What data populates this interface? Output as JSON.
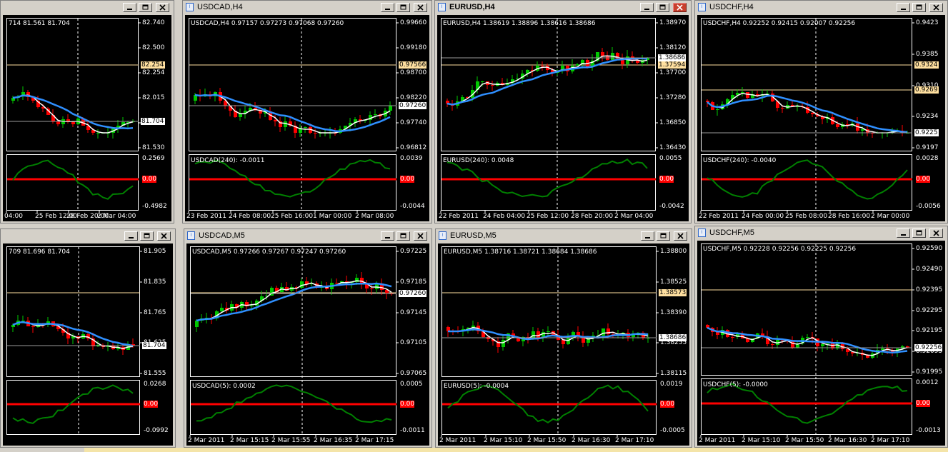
{
  "colors": {
    "bull": "#00c800",
    "bear": "#ff0000",
    "fast_ma": "#ffffff",
    "slow_ma": "#2f8fff",
    "osc": "#008000",
    "zero": "#ff0000",
    "level": "#ffe0a0"
  },
  "icons": {
    "minimize": "minimize-icon",
    "restore": "restore-icon",
    "close": "close-icon",
    "chart": "chart-window-icon"
  },
  "windows": [
    {
      "id": "w1",
      "title": "",
      "info": "714 81.561 81.704",
      "osc_label": "",
      "close_red": false,
      "price_labels": [
        "82.740",
        "82.500",
        "82.254",
        "82.015",
        "81.780",
        "81.530"
      ],
      "osc_levels": [
        "0.2569",
        "0.00",
        "-0.4982"
      ],
      "time_labels": [
        "04:00",
        "25 Feb 12:00",
        "28 Feb 20:00",
        "2 Mar 04:00"
      ],
      "current_price": "81.704",
      "level_tags": [
        "82.254"
      ]
    },
    {
      "id": "w2",
      "title": "USDCAD,H4",
      "info": "USDCAD,H4  0.97157 0.97273 0.97068 0.97260",
      "osc_label": "USDCAD(240):  -0.0011",
      "close_red": false,
      "price_labels": [
        "0.99660",
        "0.99180",
        "0.98700",
        "0.98220",
        "0.97740",
        "0.96812"
      ],
      "osc_levels": [
        "0.0039",
        "0.00",
        "-0.0044"
      ],
      "time_labels": [
        "23 Feb 2011",
        "24 Feb 08:00",
        "25 Feb 16:00",
        "1 Mar 00:00",
        "2 Mar 08:00"
      ],
      "current_price": "0.97260",
      "level_tags": [
        "0.97566"
      ]
    },
    {
      "id": "w3",
      "title": "EURUSD,H4",
      "info": "EURUSD,H4  1.38619 1.38896 1.38616 1.38686",
      "osc_label": "EURUSD(240):  0.0048",
      "close_red": true,
      "price_labels": [
        "1.38970",
        "1.38120",
        "1.37700",
        "1.37280",
        "1.36850",
        "1.36430"
      ],
      "osc_levels": [
        "0.0055",
        "0.00",
        "-0.0042"
      ],
      "time_labels": [
        "22 Feb 2011",
        "24 Feb 04:00",
        "25 Feb 12:00",
        "28 Feb 20:00",
        "2 Mar 04:00"
      ],
      "current_price": "1.38686",
      "level_tags": [
        "1.37594"
      ]
    },
    {
      "id": "w4",
      "title": "USDCHF,H4",
      "info": "USDCHF,H4  0.92252 0.92415 0.92007 0.92256",
      "osc_label": "USDCHF(240):  -0.0040",
      "close_red": false,
      "price_labels": [
        "0.9423",
        "0.9385",
        "0.9310",
        "0.9234",
        "0.9197"
      ],
      "osc_levels": [
        "0.0028",
        "0.00",
        "-0.0056"
      ],
      "time_labels": [
        "22 Feb 2011",
        "24 Feb 00:00",
        "25 Feb 08:00",
        "28 Feb 16:00",
        "2 Mar 00:00"
      ],
      "current_price": "0.9225",
      "level_tags": [
        "0.9324",
        "0.9269"
      ]
    },
    {
      "id": "w5",
      "title": "",
      "info": "709 81.696 81.704",
      "osc_label": "",
      "close_red": false,
      "price_labels": [
        "81.905",
        "81.835",
        "81.765",
        "81.625",
        "81.555"
      ],
      "osc_levels": [
        "0.0268",
        "0.00",
        "-0.0992"
      ],
      "time_labels": [
        "",
        "",
        ""
      ],
      "current_price": "81.704",
      "level_tags": []
    },
    {
      "id": "w6",
      "title": "USDCAD,M5",
      "info": "USDCAD,M5  0.97266 0.97267 0.97247 0.97260",
      "osc_label": "USDCAD(5):  0.0002",
      "close_red": false,
      "price_labels": [
        "0.97225",
        "0.97185",
        "0.97145",
        "0.97105",
        "0.97065"
      ],
      "osc_levels": [
        "0.0005",
        "0.00",
        "-0.0011"
      ],
      "time_labels": [
        "2 Mar 2011",
        "2 Mar 15:15",
        "2 Mar 15:55",
        "2 Mar 16:35",
        "2 Mar 17:15"
      ],
      "current_price": "0.97260",
      "level_tags": []
    },
    {
      "id": "w7",
      "title": "EURUSD,M5",
      "info": "EURUSD,M5  1.38716 1.38721 1.38684 1.38686",
      "osc_label": "EURUSD(5):  -0.0004",
      "close_red": false,
      "price_labels": [
        "1.38800",
        "1.38525",
        "1.38390",
        "1.38255",
        "1.38115"
      ],
      "osc_levels": [
        "0.0019",
        "0.00",
        "-0.0005"
      ],
      "time_labels": [
        "2 Mar 2011",
        "2 Mar 15:10",
        "2 Mar 15:50",
        "2 Mar 16:30",
        "2 Mar 17:10"
      ],
      "current_price": "1.38686",
      "level_tags": [
        "1.38573"
      ]
    },
    {
      "id": "w8",
      "title": "USDCHF,M5",
      "info": "USDCHF,M5  0.92228 0.92256 0.92225 0.92256",
      "osc_label": "USDCHF(5):  -0.0000",
      "close_red": false,
      "price_labels": [
        "0.92590",
        "0.92490",
        "0.92395",
        "0.92295",
        "0.92195",
        "0.92095",
        "0.91995"
      ],
      "osc_levels": [
        "0.0012",
        "0.00",
        "-0.0013"
      ],
      "time_labels": [
        "2 Mar 2011",
        "2 Mar 15:10",
        "2 Mar 15:50",
        "2 Mar 16:30",
        "2 Mar 17:10"
      ],
      "current_price": "0.92256",
      "level_tags": []
    }
  ]
}
